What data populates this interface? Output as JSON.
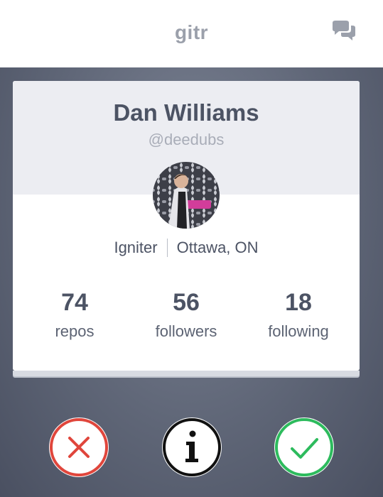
{
  "header": {
    "title": "gitr",
    "chat_icon": "chat-bubbles-icon"
  },
  "profile": {
    "name": "Dan Williams",
    "handle": "@deedubs",
    "avatar_icon": "user-photo",
    "company": "Igniter",
    "location": "Ottawa, ON",
    "stats": [
      {
        "value": "74",
        "label": "repos"
      },
      {
        "value": "56",
        "label": "followers"
      },
      {
        "value": "18",
        "label": "following"
      }
    ]
  },
  "actions": {
    "reject_icon": "x-icon",
    "info_icon": "info-icon",
    "accept_icon": "check-icon",
    "colors": {
      "reject": "#e0463c",
      "info": "#111111",
      "accept": "#2dbb5d"
    }
  },
  "colors": {
    "background": "#5f6677",
    "card_header": "#ecedf2",
    "text_primary": "#4c5364",
    "text_muted": "#a9adb8"
  }
}
